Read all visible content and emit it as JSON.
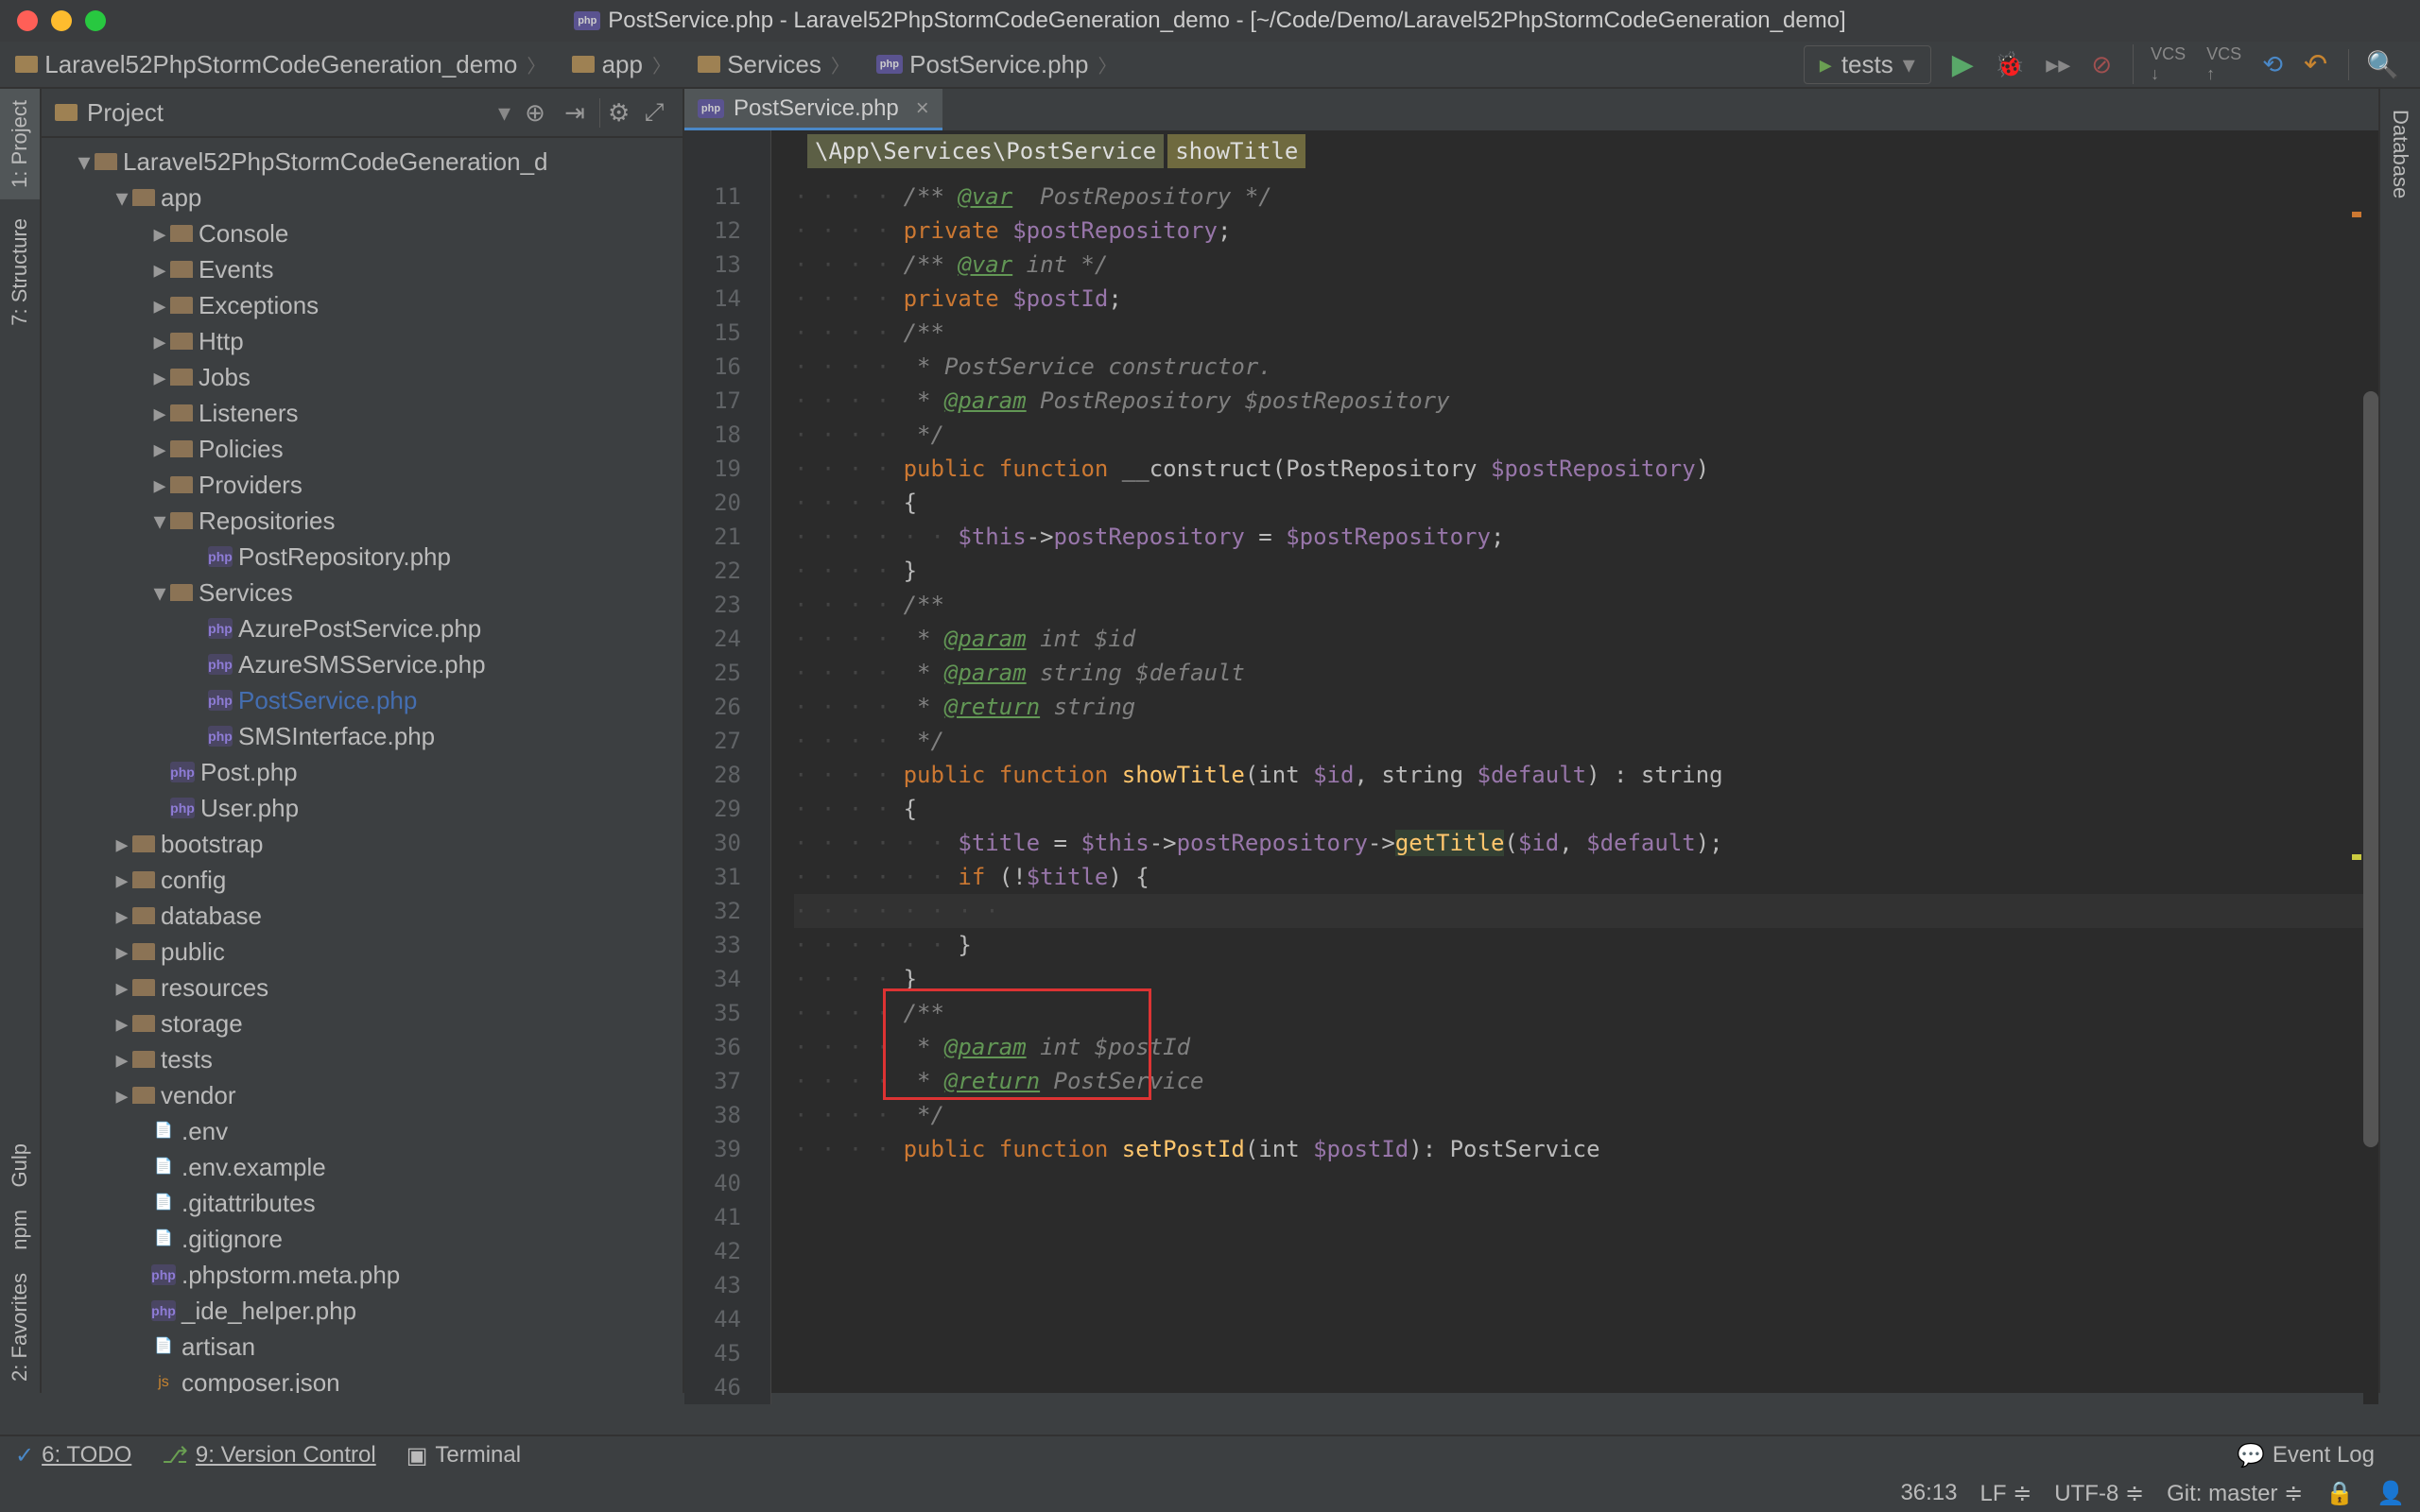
{
  "window": {
    "title": "PostService.php - Laravel52PhpStormCodeGeneration_demo - [~/Code/Demo/Laravel52PhpStormCodeGeneration_demo]"
  },
  "breadcrumb": [
    "Laravel52PhpStormCodeGeneration_demo",
    "app",
    "Services",
    "PostService.php"
  ],
  "run_config": "tests",
  "left_tabs": [
    "1: Project",
    "7: Structure",
    "Gulp",
    "npm",
    "2: Favorites"
  ],
  "right_tab": "Database",
  "project_header": "Project",
  "tree": {
    "root": "Laravel52PhpStormCodeGeneration_d",
    "app": "app",
    "app_children": [
      "Console",
      "Events",
      "Exceptions",
      "Http",
      "Jobs",
      "Listeners",
      "Policies",
      "Providers",
      "Repositories"
    ],
    "repo_file": "PostRepository.php",
    "services": "Services",
    "services_files": [
      "AzurePostService.php",
      "AzureSMSService.php",
      "PostService.php",
      "SMSInterface.php"
    ],
    "app_files": [
      "Post.php",
      "User.php"
    ],
    "root_dirs": [
      "bootstrap",
      "config",
      "database",
      "public",
      "resources",
      "storage",
      "tests",
      "vendor"
    ],
    "root_files": [
      ".env",
      ".env.example",
      ".gitattributes",
      ".gitignore",
      ".phpstorm.meta.php",
      "_ide_helper.php",
      "artisan",
      "composer.json"
    ]
  },
  "editor": {
    "tab": "PostService.php",
    "namespace_crumb": "\\App\\Services\\PostService",
    "method_crumb": "showTitle",
    "lines_start": 11,
    "lines_end": 46
  },
  "code": {
    "l11": "/** @var  PostRepository */",
    "l12_kw": "private ",
    "l12_var": "$postRepository",
    "l12_end": ";",
    "l14": "/** @var int */",
    "l15_kw": "private ",
    "l15_var": "$postId",
    "l15_end": ";",
    "l17": "/**",
    "l18": " * PostService constructor.",
    "l19_a": " * ",
    "l19_tag": "@param",
    "l19_b": " PostRepository $postRepository",
    "l20": " */",
    "l21_pub": "public ",
    "l21_fn": "function ",
    "l21_name": "__construct",
    "l21_sig": "(PostRepository ",
    "l21_v": "$postRepository",
    "l21_close": ")",
    "l22": "{",
    "l23_a": "$this->",
    "l23_b": "postRepository",
    "l23_c": " = ",
    "l23_d": "$postRepository",
    "l23_e": ";",
    "l24": "}",
    "l26": "/**",
    "l27_a": " * ",
    "l27_tag": "@param",
    "l27_b": " int $id",
    "l28_a": " * ",
    "l28_tag": "@param",
    "l28_b": " string $default",
    "l29_a": " * ",
    "l29_tag": "@return",
    "l29_b": " string",
    "l30": " */",
    "l31_pub": "public ",
    "l31_fn": "function ",
    "l31_name": "showTitle",
    "l31_sig": "(int ",
    "l31_v1": "$id",
    "l31_c1": ", string ",
    "l31_v2": "$default",
    "l31_c2": ") : string",
    "l32": "{",
    "l33_a": "$title",
    "l33_b": " = ",
    "l33_c": "$this->",
    "l33_d": "postRepository",
    "l33_e": "->",
    "l33_f": "getTitle",
    "l33_g": "(",
    "l33_h": "$id",
    "l33_i": ", ",
    "l33_j": "$default",
    "l33_k": ");",
    "l35_if": "if ",
    "l35_a": "(!",
    "l35_v": "$title",
    "l35_b": ") {",
    "l37": "}",
    "l40": "}",
    "l42": "/**",
    "l43_a": " * ",
    "l43_tag": "@param",
    "l43_b": " int $postId",
    "l44_a": " * ",
    "l44_tag": "@return",
    "l44_b": " PostService",
    "l45": " */",
    "l46_pub": "public ",
    "l46_fn": "function ",
    "l46_name": "setPostId",
    "l46_sig": "(int ",
    "l46_v": "$postId",
    "l46_c": "): PostService"
  },
  "status_bar": {
    "todo": "6: TODO",
    "vcs": "9: Version Control",
    "terminal": "Terminal",
    "event_log": "Event Log"
  },
  "status_right": {
    "pos": "36:13",
    "le": "LF",
    "le_arrow": "≑",
    "enc": "UTF-8",
    "enc_arrow": "≑",
    "git": "Git: master",
    "git_arrow": "≑"
  }
}
